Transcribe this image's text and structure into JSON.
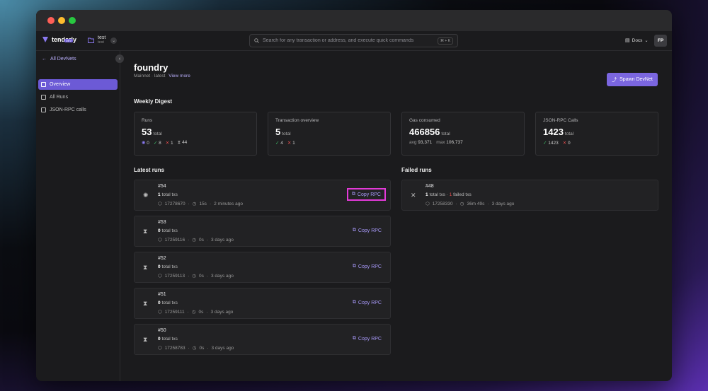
{
  "topbar": {
    "logo": "tenderly",
    "logo_badge": "DEV",
    "project_name": "test",
    "project_sub": "test",
    "search_placeholder": "Search for any transaction or address, and execute quick commands",
    "search_shortcut": "⌘ + K",
    "docs_label": "Docs",
    "avatar_initials": "FP"
  },
  "sidebar": {
    "back_label": "All DevNets",
    "items": [
      {
        "label": "Overview",
        "active": true,
        "icon": "home-icon"
      },
      {
        "label": "All Runs",
        "active": false,
        "icon": "file-icon"
      },
      {
        "label": "JSON-RPC calls",
        "active": false,
        "icon": "database-icon"
      }
    ]
  },
  "header": {
    "title": "foundry",
    "subtitle": "Mainnet · latest",
    "view_more": "View more",
    "spawn_label": "Spawn DevNet"
  },
  "digest": {
    "title": "Weekly Digest",
    "runs": {
      "label": "Runs",
      "value": "53",
      "unit": "total",
      "running": "0",
      "success": "8",
      "failed": "1",
      "pending": "44"
    },
    "tx": {
      "label": "Transaction overview",
      "value": "5",
      "unit": "total",
      "success": "4",
      "failed": "1"
    },
    "gas": {
      "label": "Gas consumed",
      "value": "466856",
      "unit": "total",
      "avg_label": "avg",
      "avg": "93,371",
      "max_label": "max",
      "max": "106,737"
    },
    "rpc": {
      "label": "JSON-RPC Calls",
      "value": "1423",
      "unit": "total",
      "success": "1423",
      "failed": "0"
    }
  },
  "latest_runs": {
    "title": "Latest runs",
    "copy_label": "Copy RPC",
    "runs": [
      {
        "id": "#54",
        "txs": "1",
        "txs_label": "total txs",
        "block": "17278670",
        "duration": "15s",
        "time": "2 minutes ago",
        "status": "running"
      },
      {
        "id": "#53",
        "txs": "0",
        "txs_label": "total txs",
        "block": "17259116",
        "duration": "0s",
        "time": "3 days ago",
        "status": "pending"
      },
      {
        "id": "#52",
        "txs": "0",
        "txs_label": "total txs",
        "block": "17259113",
        "duration": "0s",
        "time": "3 days ago",
        "status": "pending"
      },
      {
        "id": "#51",
        "txs": "0",
        "txs_label": "total txs",
        "block": "17259111",
        "duration": "0s",
        "time": "3 days ago",
        "status": "pending"
      },
      {
        "id": "#50",
        "txs": "0",
        "txs_label": "total txs",
        "block": "17258783",
        "duration": "0s",
        "time": "3 days ago",
        "status": "pending"
      }
    ]
  },
  "failed_runs": {
    "title": "Failed runs",
    "runs": [
      {
        "id": "#48",
        "txs": "1",
        "txs_label": "total txs",
        "failed": "1",
        "failed_label": "failed txs",
        "block": "17258330",
        "duration": "36m 49s",
        "time": "3 days ago"
      }
    ]
  }
}
